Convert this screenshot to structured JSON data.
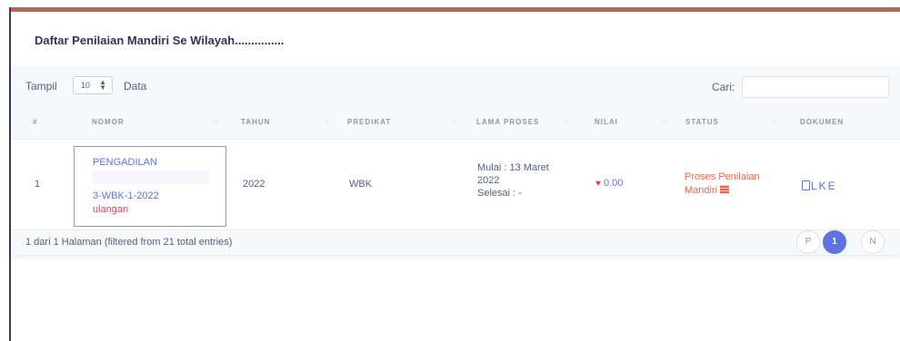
{
  "card": {
    "title": "Daftar Penilaian Mandiri Se Wilayah..............."
  },
  "toolbar": {
    "show_label": "Tampil",
    "page_length": "10",
    "data_label": "Data",
    "search_label": "Cari:",
    "search_value": ""
  },
  "table": {
    "columns": [
      "#",
      "NOMOR",
      "TAHUN",
      "PREDIKAT",
      "LAMA PROSES",
      "NILAI",
      "STATUS",
      "DOKUMEN"
    ],
    "rows": [
      {
        "no": "1",
        "nomor_name": "PENGADILAN",
        "nomor_code": "3-WBK-1-2022",
        "nomor_flag": "ulangan",
        "tahun": "2022",
        "predikat": "WBK",
        "lama_mulai": "Mulai : 13 Maret",
        "lama_tahun": "2022",
        "lama_selesai": "Selesai : -",
        "nilai": "0.00",
        "status_line1": "Proses Penilaian",
        "status_line2": "Mandiri",
        "dokumen": "LKE"
      }
    ]
  },
  "footer": {
    "info": "1 dari 1 Halaman (filtered from 21 total entries)",
    "prev_label": "P",
    "current_page": "1",
    "next_label": "N"
  },
  "colors": {
    "accent": "#5e72e4",
    "danger": "#f5365c",
    "warning": "#fb6340",
    "header_bg": "#f6f9fc"
  },
  "icons": {
    "sort": "sort-arrows-icon",
    "select": "select-arrows-icon",
    "nilai": "heart-broken-icon",
    "status": "list-icon",
    "dokumen": "document-icon"
  }
}
